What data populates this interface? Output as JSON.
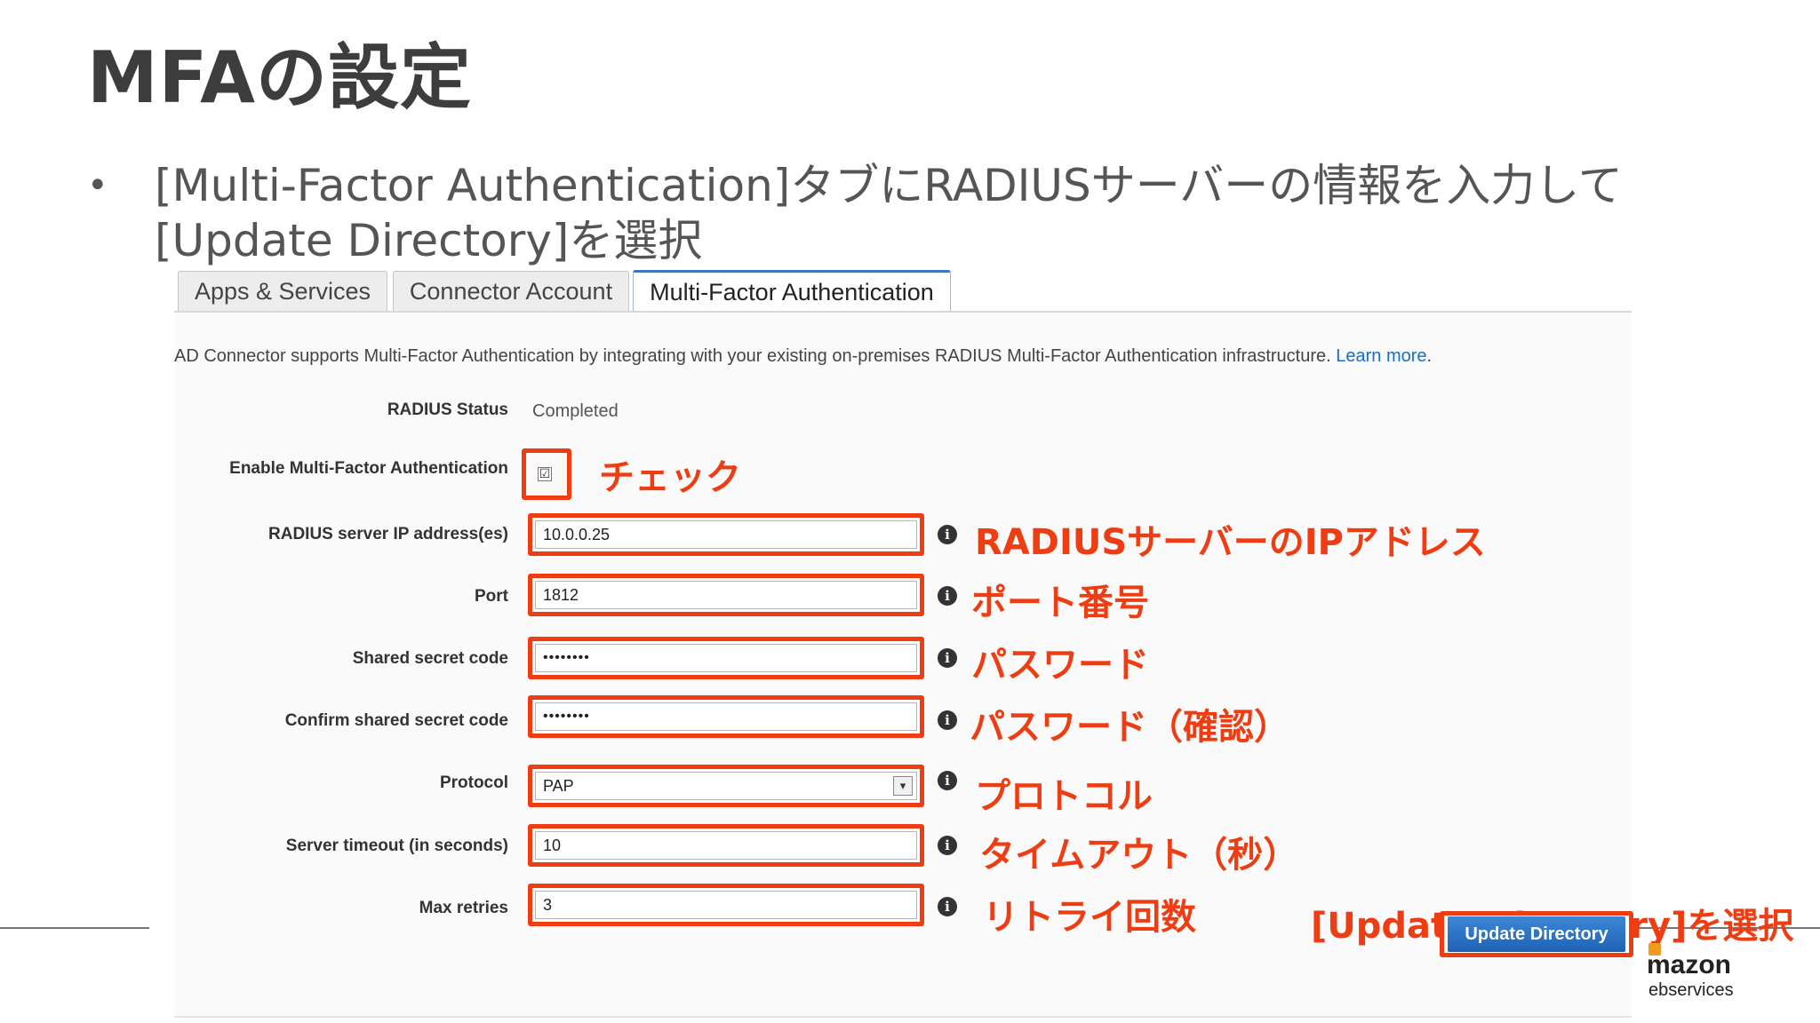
{
  "slide": {
    "title": "MFAの設定",
    "bullet_symbol": "•",
    "bullet_line1": "[Multi-Factor Authentication]タブにRADIUSサーバーの情報を入力して",
    "bullet_line2": "[Update Directory]を選択"
  },
  "tabs": [
    {
      "label": "Apps & Services",
      "active": false
    },
    {
      "label": "Connector Account",
      "active": false
    },
    {
      "label": "Multi-Factor Authentication",
      "active": true
    }
  ],
  "panel": {
    "description": "AD Connector supports Multi-Factor Authentication by integrating with your existing on-premises RADIUS Multi-Factor Authentication infrastructure.",
    "learn_more": "Learn more",
    "learn_more_suffix": "."
  },
  "form": {
    "radius_status": {
      "label": "RADIUS Status",
      "value": "Completed"
    },
    "enable_mfa": {
      "label": "Enable Multi-Factor Authentication",
      "checked": true,
      "check_glyph": "☑",
      "annotation": "チェック"
    },
    "server_ip": {
      "label": "RADIUS server IP address(es)",
      "value": "10.0.0.25",
      "annotation": "RADIUSサーバーのIPアドレス"
    },
    "port": {
      "label": "Port",
      "value": "1812",
      "annotation": "ポート番号"
    },
    "shared_secret": {
      "label": "Shared secret code",
      "value": "••••••••",
      "annotation": "パスワード"
    },
    "confirm_secret": {
      "label": "Confirm shared secret code",
      "value": "••••••••",
      "annotation": "パスワード（確認）"
    },
    "protocol": {
      "label": "Protocol",
      "value": "PAP",
      "annotation": "プロトコル"
    },
    "server_timeout": {
      "label": "Server timeout (in seconds)",
      "value": "10",
      "annotation": "タイムアウト（秒）"
    },
    "max_retries": {
      "label": "Max retries",
      "value": "3",
      "annotation": "リトライ回数"
    }
  },
  "info_glyph": "i",
  "select_arrow_glyph": "▾",
  "update": {
    "button_label": "Update Directory",
    "annotation": "[Update Directory]を選択"
  },
  "logo": {
    "line1": "mazon",
    "line2": "ebservices"
  },
  "colors": {
    "highlight": "#ee3d12",
    "accent": "#1f62b4",
    "link": "#1a6ec2"
  }
}
